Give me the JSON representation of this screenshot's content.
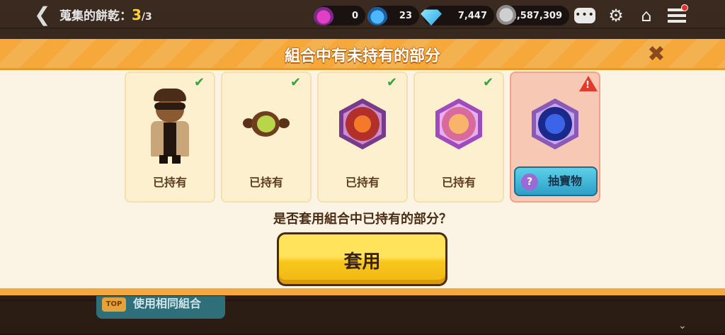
{
  "hud": {
    "back_icon": "chevron-left-icon",
    "title_label": "蒐集的餅乾：",
    "collected": "3",
    "total": "/3",
    "resources": [
      {
        "icon": "purple-potion-icon",
        "value": "0"
      },
      {
        "icon": "blue-potion-icon",
        "value": "23"
      },
      {
        "icon": "crystal-icon",
        "value": "7,447"
      },
      {
        "icon": "coin-icon",
        "value": "1,587,309"
      }
    ],
    "icons": [
      "chat-icon",
      "gear-icon",
      "home-icon",
      "menu-icon"
    ]
  },
  "modal": {
    "title": "組合中有未持有的部分",
    "close_icon": "close-icon",
    "cards": [
      {
        "name": "cookie",
        "status": "已持有",
        "owned": true
      },
      {
        "name": "pet",
        "status": "已持有",
        "owned": true
      },
      {
        "name": "treasure-red",
        "status": "已持有",
        "owned": true
      },
      {
        "name": "treasure-orange",
        "status": "已持有",
        "owned": true
      },
      {
        "name": "treasure-blue",
        "status": "抽寶物",
        "owned": false
      }
    ],
    "question": "是否套用組合中已持有的部分？",
    "apply_label": "套用"
  },
  "footer": {
    "same_combo_label": "使用相同組合",
    "top_badge": "TOP"
  },
  "colors": {
    "banner_orange": "#f6a93a",
    "owned_check": "#31a83a",
    "warning_red": "#e23a2c",
    "apply_yellow": "#f7c71d",
    "gacha_teal": "#2f9fc8"
  }
}
